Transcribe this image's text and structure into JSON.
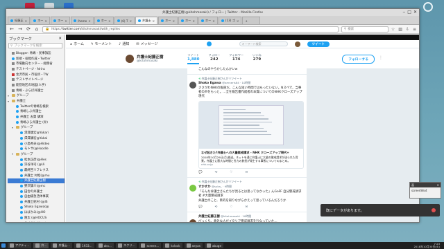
{
  "desktop": {
    "notification": {
      "text": "既にデータがあります。"
    },
    "mini_window": {
      "title": "画",
      "body": "screenShot"
    }
  },
  "browser": {
    "title": "弁護士紀藤正樹(@kitohmasaki) / フォロー | Twitter - Mozilla Firefox",
    "tabs": [
      {
        "label": "紀藤正"
      },
      {
        "label": "ホー"
      },
      {
        "label": "ホー"
      },
      {
        "label": "/home"
      },
      {
        "label": "ホー"
      },
      {
        "label": "(6) T"
      },
      {
        "label": "弁護士",
        "active": true
      },
      {
        "label": "ホー"
      },
      {
        "label": "ホー"
      },
      {
        "label": "ホー"
      },
      {
        "label": "(13) ゴ"
      }
    ],
    "url_prefix": "https://",
    "url_host": "twitter.com",
    "url_path": "/kitohmasaki/with_replies",
    "search_placeholder": "検索"
  },
  "sidebar": {
    "title": "ブックマーク",
    "search_placeholder": "ブックマークを検索",
    "items": [
      {
        "label": "Blogger: 青嶋・民事訴訟",
        "icon": "gen",
        "indent": 1
      },
      {
        "label": "新規・投稿作成・Twitter",
        "icon": "tw",
        "indent": 1
      },
      {
        "label": "市場動向センター・総務省",
        "icon": "gen",
        "indent": 1
      },
      {
        "label": "テストページ - Nrinc",
        "icon": "gen",
        "indent": 1
      },
      {
        "label": "金沢市民・市役所・TW",
        "icon": "red",
        "indent": 1
      },
      {
        "label": "テストサイトページ",
        "icon": "gen",
        "indent": 1
      },
      {
        "label": "能登地区の地図(人手)",
        "icon": "gen",
        "indent": 1
      },
      {
        "label": "青嶋・ぶらぼ弁護士",
        "icon": "gen",
        "indent": 1
      },
      {
        "label": "グループ",
        "icon": "folder",
        "indent": 0
      },
      {
        "label": "弁護士",
        "icon": "folder",
        "indent": 0
      },
      {
        "label": "Twitterの青嶋を検索",
        "icon": "tw",
        "indent": 2
      },
      {
        "label": "青嶋しぶ弁護士",
        "icon": "tw",
        "indent": 2
      },
      {
        "label": "弁護士 志賀 講演",
        "icon": "tw",
        "indent": 2
      },
      {
        "label": "青嶋ぶら弁護士 (弁)",
        "icon": "tw",
        "indent": 2
      },
      {
        "label": "グループ",
        "icon": "folder",
        "indent": 1
      },
      {
        "label": "澤澤康宏@Yukari",
        "icon": "tw",
        "indent": 3
      },
      {
        "label": "澤澤康宏@Yukai",
        "icon": "tw",
        "indent": 3
      },
      {
        "label": "小島秀夫(@Hideo",
        "icon": "tw",
        "indent": 3
      },
      {
        "label": "モトサ(@Hoodle",
        "icon": "tw",
        "indent": 3
      },
      {
        "label": "グループ",
        "icon": "folder",
        "indent": 1
      },
      {
        "label": "松本正彦(@Hes",
        "icon": "tw",
        "indent": 3
      },
      {
        "label": "深谷洋司 (@Ui",
        "icon": "tw",
        "indent": 3
      },
      {
        "label": "最終回リフレクス",
        "icon": "tw",
        "indent": 3
      },
      {
        "label": "弁護士 村松(@mu",
        "icon": "tw",
        "indent": 3
      },
      {
        "label": "弁護士紀藤正樹",
        "icon": "tw",
        "indent": 3,
        "selected": true
      },
      {
        "label": "野沢康介(@mc",
        "icon": "tw",
        "indent": 3
      },
      {
        "label": "田舎の弁護士",
        "icon": "tw",
        "indent": 3
      },
      {
        "label": "自由緩急活体事業",
        "icon": "tw",
        "indent": 3
      },
      {
        "label": "弁護士紀村 (@IS",
        "icon": "tw",
        "indent": 3
      },
      {
        "label": "Shoko Egawa(@",
        "icon": "tw",
        "indent": 3
      },
      {
        "label": "ほばかみ(@HO",
        "icon": "tw",
        "indent": 3
      },
      {
        "label": "隆太 (@HOCUS",
        "icon": "tw",
        "indent": 3
      },
      {
        "label": "サイド(@Horatsu",
        "icon": "tw",
        "indent": 3
      },
      {
        "label": "かばかお中学",
        "icon": "tw",
        "indent": 3
      }
    ]
  },
  "twitter": {
    "nav": {
      "home": "ホーム",
      "moments": "モーメント",
      "notifications": "通知",
      "messages": "メッセージ"
    },
    "search_placeholder": "キーワード検索",
    "tweet_button": "ツイート",
    "profile": {
      "name": "弁護士紀藤正樹",
      "handle": "@kitohmasaki"
    },
    "stats": [
      {
        "label": "ツイート",
        "value": "1,880",
        "active": true
      },
      {
        "label": "フォロー",
        "value": "242"
      },
      {
        "label": "フォロワー",
        "value": "174"
      },
      {
        "label": "いいね",
        "value": "279"
      }
    ],
    "follow_button": "フォローする",
    "tweets": [
      {
        "retweet": "",
        "name": "",
        "handle": "",
        "text": "こんなのやらかしたんかいw",
        "has_card": false,
        "av_color": "#ffffff"
      },
      {
        "retweet": "弁護士紀藤正樹さんがリツイート",
        "name": "Shoko Egawa",
        "handle": "@amneris84 · 10時間",
        "text": "ささがわNHKの報道だ。こんな短い時間ではもったいない。Nスペで、当事者の声をもっと。…全を報告書作成者の本質についてのNHKクローズアップ現代",
        "has_card": true,
        "card_title": "なぜ起きた?弁護士への大量懲戒請求 - NHK クローズアップ現代+",
        "card_desc": "2018年10月29日(月)放送。ネットを通じ弁護士に大量の懲戒請求が送られた背景。弁護士に膨大な時間と労力の負担が発生する事態についてのまとめ。",
        "card_domain": "nhk.or.jp",
        "av_color": "#555555"
      },
      {
        "retweet": "弁護士紀藤正樹さんがリツイート",
        "name": "すかすか",
        "handle": "@suka_ · 9時間",
        "text": "「そんな弁護士さんたちが見るとは思ってなかった」んGoFF 自分懲戒請求者 #大量懲戒請求",
        "text2": "弁護士のこと、目的を知りながらかえって思っているんだろうか",
        "has_card": false,
        "av_color": "#7ac943"
      },
      {
        "retweet": "",
        "name": "弁護士紀藤正樹",
        "handle": "@kitohmasaki · 10時間",
        "text": "びっくり。意外な人がイタリア懲戒請求を行なっていた…",
        "text2": "",
        "has_card": false,
        "av_color": "#6b4a32"
      }
    ]
  },
  "taskbar": {
    "items": [
      "アクティ...",
      "弁...",
      "弁護士...",
      "1933...",
      "aks...",
      "スクリ...",
      "screen...",
      "kclock",
      "aeyas",
      "abuge"
    ],
    "clock_time": "7:23",
    "clock_date": "2018年10月30日(火)"
  },
  "colors": {
    "accent": "#1da1f2",
    "desktop": "#5e96ac",
    "taskbar": "#1f1f1f"
  }
}
